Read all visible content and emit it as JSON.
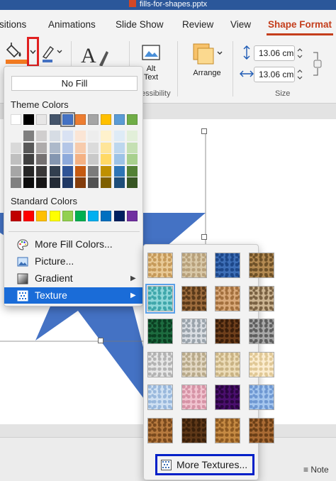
{
  "window": {
    "title": "fills-for-shapes.pptx"
  },
  "tabs": [
    {
      "label": "sitions",
      "active": false
    },
    {
      "label": "Animations",
      "active": false
    },
    {
      "label": "Slide Show",
      "active": false
    },
    {
      "label": "Review",
      "active": false
    },
    {
      "label": "View",
      "active": false
    },
    {
      "label": "Shape Format",
      "active": true
    }
  ],
  "ribbon": {
    "alt_text": "Alt\nText",
    "accessibility_label": "essibility",
    "arrange_label": "Arrange",
    "height_value": "13.06 cm",
    "width_value": "13.06 cm",
    "size_label": "Size"
  },
  "fill_menu": {
    "no_fill": "No Fill",
    "theme_colors_label": "Theme Colors",
    "theme_colors": [
      "#ffffff",
      "#000000",
      "#e7e6e6",
      "#44546a",
      "#4472c4",
      "#ed7d31",
      "#a5a5a5",
      "#ffc000",
      "#5b9bd5",
      "#70ad47"
    ],
    "theme_shades": [
      [
        "#f2f2f2",
        "#d9d9d9",
        "#bfbfbf",
        "#a6a6a6",
        "#808080"
      ],
      [
        "#808080",
        "#595959",
        "#404040",
        "#262626",
        "#0d0d0d"
      ],
      [
        "#d0cece",
        "#aeabab",
        "#757171",
        "#3a3838",
        "#171616"
      ],
      [
        "#d6dce4",
        "#adb9ca",
        "#8496b0",
        "#323f4f",
        "#222a35"
      ],
      [
        "#d9e2f3",
        "#b4c6e7",
        "#8eaadb",
        "#2f5496",
        "#1f3864"
      ],
      [
        "#fbe5d5",
        "#f7cbac",
        "#f4b183",
        "#c55a11",
        "#833c0b"
      ],
      [
        "#ededed",
        "#dbdbdb",
        "#c9c9c9",
        "#7b7b7b",
        "#525252"
      ],
      [
        "#fff2cc",
        "#fee599",
        "#ffd965",
        "#bf9000",
        "#7f6000"
      ],
      [
        "#deebf6",
        "#bdd7ee",
        "#9dc3e6",
        "#2e75b5",
        "#1e4e79"
      ],
      [
        "#e2efd9",
        "#c5e0b3",
        "#a8d08d",
        "#538135",
        "#375623"
      ]
    ],
    "standard_colors_label": "Standard Colors",
    "standard_colors": [
      "#c00000",
      "#ff0000",
      "#ffc000",
      "#ffff00",
      "#92d050",
      "#00b050",
      "#00b0f0",
      "#0070c0",
      "#002060",
      "#7030a0"
    ],
    "items": [
      {
        "label": "More Fill Colors...",
        "icon": "palette-icon",
        "submenu": false
      },
      {
        "label": "Picture...",
        "icon": "picture-icon",
        "submenu": false
      },
      {
        "label": "Gradient",
        "icon": "gradient-icon",
        "submenu": true
      },
      {
        "label": "Texture",
        "icon": "texture-icon",
        "submenu": true,
        "highlighted": true
      }
    ]
  },
  "texture_menu": {
    "textures": [
      {
        "name": "papyrus",
        "base": "#e8c996",
        "dot": "#c69a5a"
      },
      {
        "name": "canvas",
        "base": "#d8c8a8",
        "dot": "#b7a07a"
      },
      {
        "name": "denim",
        "base": "#3e6fb7",
        "dot": "#1d4789"
      },
      {
        "name": "woven-mat",
        "base": "#b38a52",
        "dot": "#6e5128"
      },
      {
        "name": "water-droplets",
        "base": "#8ed6d8",
        "dot": "#3fa7ab"
      },
      {
        "name": "paper-bag",
        "base": "#9c6b3c",
        "dot": "#5a3a1a"
      },
      {
        "name": "fish-fossil",
        "base": "#d9a97a",
        "dot": "#a3703e"
      },
      {
        "name": "sand",
        "base": "#cbb491",
        "dot": "#7a6243"
      },
      {
        "name": "green-marble",
        "base": "#1d6b3f",
        "dot": "#0b3f22"
      },
      {
        "name": "white-marble",
        "base": "#d9dde2",
        "dot": "#9aa3ab"
      },
      {
        "name": "brown-marble",
        "base": "#6e3f1c",
        "dot": "#3b1e0a"
      },
      {
        "name": "granite",
        "base": "#a8a8a8",
        "dot": "#5e5e5e"
      },
      {
        "name": "newsprint",
        "base": "#e6e6e6",
        "dot": "#b3b3b3"
      },
      {
        "name": "recycled-paper",
        "base": "#e2d7c2",
        "dot": "#b8a98a"
      },
      {
        "name": "parchment",
        "base": "#ecdcb8",
        "dot": "#c9b384"
      },
      {
        "name": "stationery",
        "base": "#fbeccf",
        "dot": "#e0c896"
      },
      {
        "name": "blue-tissue-paper",
        "base": "#cfe0f2",
        "dot": "#99b8dc"
      },
      {
        "name": "pink-tissue-paper",
        "base": "#f0c3cf",
        "dot": "#d693a6"
      },
      {
        "name": "purple-mesh",
        "base": "#4b0f6e",
        "dot": "#2a0640"
      },
      {
        "name": "bouquet",
        "base": "#a5c6ee",
        "dot": "#6f98d2"
      },
      {
        "name": "cork",
        "base": "#b77a3f",
        "dot": "#7a4a1e"
      },
      {
        "name": "walnut",
        "base": "#5e3818",
        "dot": "#3a200a"
      },
      {
        "name": "oak",
        "base": "#c58a43",
        "dot": "#8e5a22"
      },
      {
        "name": "medium-wood",
        "base": "#a96b34",
        "dot": "#6b3f17"
      }
    ],
    "more_textures": "More Textures..."
  },
  "statusbar": {
    "notes_label": "Note"
  },
  "colors": {
    "accent": "#c43e1c",
    "highlight": "#1a6cd8",
    "title_bar": "#2b579a",
    "shape_blue": "#4472c4",
    "focus_border": "#0020c8",
    "red_callout": "#e02020"
  }
}
